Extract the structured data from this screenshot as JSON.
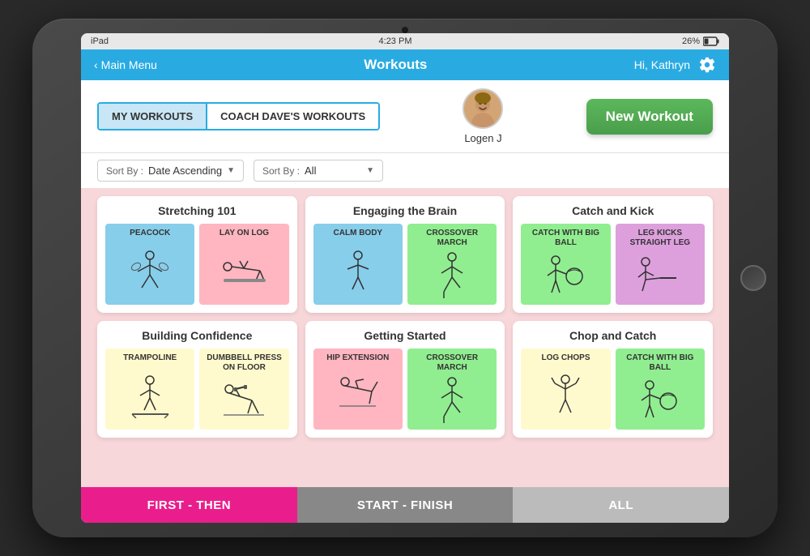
{
  "device": {
    "status_bar": {
      "left": "iPad",
      "center": "4:23 PM",
      "right": "26%"
    }
  },
  "nav": {
    "back_label": "Main Menu",
    "title": "Workouts",
    "user_greeting": "Hi, Kathryn"
  },
  "tabs": [
    {
      "id": "my",
      "label": "MY WORKOUTS",
      "active": true
    },
    {
      "id": "coach",
      "label": "COACH DAVE'S WORKOUTS",
      "active": false
    }
  ],
  "user": {
    "name": "Logen  J"
  },
  "new_workout_label": "New Workout",
  "filters": [
    {
      "id": "sort-date",
      "prefix": "Sort By : ",
      "value": "Date Ascending"
    },
    {
      "id": "sort-all",
      "prefix": "Sort By : ",
      "value": "All"
    }
  ],
  "workouts": [
    {
      "id": "stretching",
      "title": "Stretching 101",
      "exercises": [
        {
          "name": "Peacock",
          "color": "blue"
        },
        {
          "name": "LAY ON LOG",
          "color": "pink"
        }
      ]
    },
    {
      "id": "engaging",
      "title": "Engaging the Brain",
      "exercises": [
        {
          "name": "Calm Body",
          "color": "blue"
        },
        {
          "name": "CROSSOVER MARCH",
          "color": "green"
        }
      ]
    },
    {
      "id": "catch-kick",
      "title": "Catch and Kick",
      "exercises": [
        {
          "name": "CATCH WITH BIG BALL",
          "color": "green"
        },
        {
          "name": "LEG KICKS straight leg",
          "color": "purple"
        }
      ]
    },
    {
      "id": "building",
      "title": "Building Confidence",
      "exercises": [
        {
          "name": "TRAMPOLINE",
          "color": "yellow"
        },
        {
          "name": "DUMBBELL PRESS ON FLOOR",
          "color": "yellow"
        }
      ]
    },
    {
      "id": "getting-started",
      "title": "Getting Started",
      "exercises": [
        {
          "name": "HIP EXTENSION",
          "color": "pink"
        },
        {
          "name": "CROSSOVER MARCH",
          "color": "green"
        }
      ]
    },
    {
      "id": "chop-catch",
      "title": "Chop and Catch",
      "exercises": [
        {
          "name": "LOG CHOPS",
          "color": "yellow"
        },
        {
          "name": "CATCH WITH BIG BALL",
          "color": "green"
        }
      ]
    }
  ],
  "bottom_buttons": [
    {
      "id": "first-then",
      "label": "FIRST - THEN",
      "style": "pink"
    },
    {
      "id": "start-finish",
      "label": "START - FINISH",
      "style": "gray"
    },
    {
      "id": "all",
      "label": "ALL",
      "style": "light"
    }
  ]
}
